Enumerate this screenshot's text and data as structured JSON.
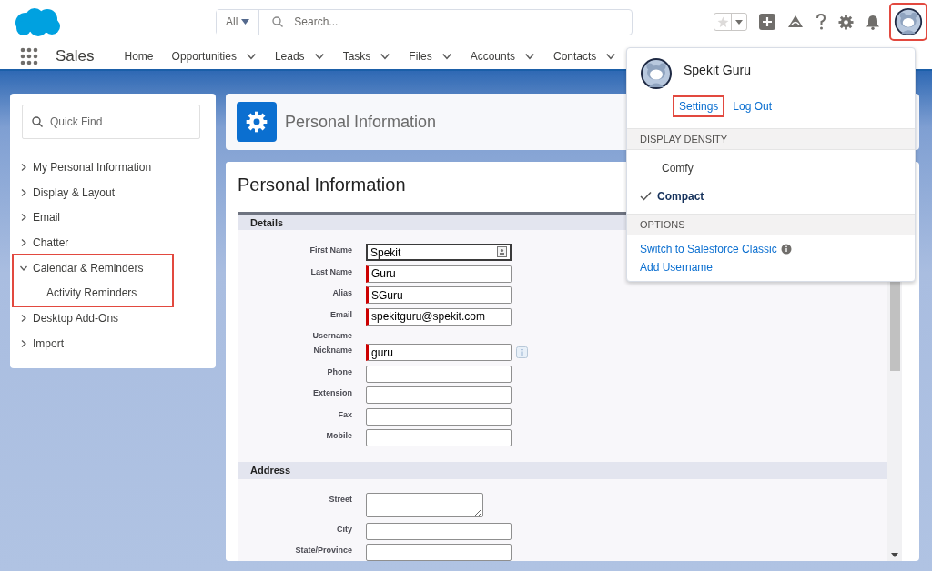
{
  "header": {
    "search": {
      "scope": "All",
      "placeholder": "Search..."
    },
    "avatar_highlighted": true
  },
  "nav": {
    "app_name": "Sales",
    "items": [
      {
        "label": "Home",
        "has_menu": false
      },
      {
        "label": "Opportunities",
        "has_menu": true
      },
      {
        "label": "Leads",
        "has_menu": true
      },
      {
        "label": "Tasks",
        "has_menu": true
      },
      {
        "label": "Files",
        "has_menu": true
      },
      {
        "label": "Accounts",
        "has_menu": true
      },
      {
        "label": "Contacts",
        "has_menu": true
      }
    ]
  },
  "sidebar": {
    "quick_find": {
      "placeholder": "Quick Find"
    },
    "items": [
      {
        "label": "My Personal Information",
        "expanded": false,
        "highlighted": false
      },
      {
        "label": "Display & Layout",
        "expanded": false,
        "highlighted": false
      },
      {
        "label": "Email",
        "expanded": false,
        "highlighted": false
      },
      {
        "label": "Chatter",
        "expanded": false,
        "highlighted": false
      },
      {
        "label": "Calendar & Reminders",
        "expanded": true,
        "highlighted": true,
        "children": [
          {
            "label": "Activity Reminders"
          }
        ]
      },
      {
        "label": "Desktop Add-Ons",
        "expanded": false,
        "highlighted": false
      },
      {
        "label": "Import",
        "expanded": false,
        "highlighted": false
      }
    ]
  },
  "page_header": {
    "title": "Personal Information"
  },
  "form": {
    "title": "Personal Information",
    "sections": [
      {
        "title": "Details",
        "fields": [
          {
            "label": "First Name",
            "kind": "text",
            "value": "Spekit",
            "required": false,
            "focused": true,
            "card_icon": true
          },
          {
            "label": "Last Name",
            "kind": "text",
            "value": "Guru",
            "required": true,
            "focused": false
          },
          {
            "label": "Alias",
            "kind": "text",
            "value": "SGuru",
            "required": true,
            "focused": false
          },
          {
            "label": "Email",
            "kind": "text",
            "value": "spekitguru@spekit.com",
            "required": true,
            "focused": false
          },
          {
            "label": "Username",
            "kind": "none"
          },
          {
            "label": "Nickname",
            "kind": "text",
            "value": "guru",
            "required": true,
            "focused": false,
            "info": true
          },
          {
            "label": "Phone",
            "kind": "text",
            "required": false,
            "focused": false
          },
          {
            "label": "Extension",
            "kind": "text",
            "required": false,
            "focused": false
          },
          {
            "label": "Fax",
            "kind": "text",
            "required": false,
            "focused": false
          },
          {
            "label": "Mobile",
            "kind": "text",
            "required": false,
            "focused": false
          }
        ]
      },
      {
        "title": "Address",
        "fields": [
          {
            "label": "Street",
            "kind": "textarea",
            "required": false,
            "focused": false
          },
          {
            "label": "City",
            "kind": "text",
            "required": false,
            "focused": false
          },
          {
            "label": "State/Province",
            "kind": "text",
            "required": false,
            "focused": false
          }
        ]
      }
    ]
  },
  "user_menu": {
    "name": "Spekit Guru",
    "links": [
      {
        "label": "Settings",
        "highlighted": true
      },
      {
        "label": "Log Out",
        "highlighted": false
      }
    ],
    "density": {
      "title": "DISPLAY DENSITY",
      "options": [
        {
          "label": "Comfy",
          "selected": false
        },
        {
          "label": "Compact",
          "selected": true
        }
      ]
    },
    "options": {
      "title": "OPTIONS",
      "items": [
        {
          "label": "Switch to Salesforce Classic",
          "info": true
        },
        {
          "label": "Add Username",
          "info": false
        }
      ]
    }
  }
}
